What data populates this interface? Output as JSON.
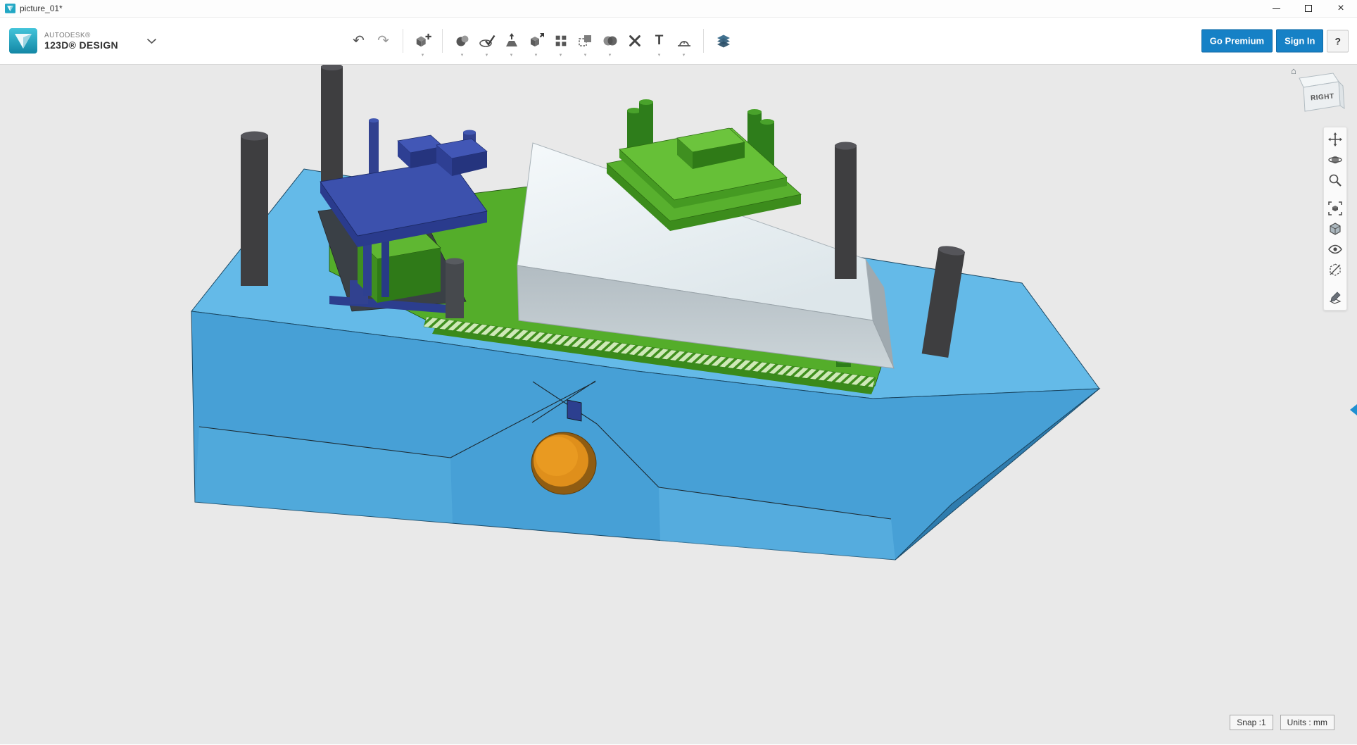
{
  "window": {
    "title": "picture_01*",
    "close_glyph": "×"
  },
  "header": {
    "brand_line1": "AUTODESK®",
    "brand_line2": "123D® DESIGN",
    "go_premium_label": "Go Premium",
    "sign_in_label": "Sign In",
    "help_label": "?"
  },
  "toolbar": {
    "undo_glyph": "↶",
    "redo_glyph": "↷",
    "text_glyph": "T",
    "drop_glyph": "▾",
    "items": [
      "undo",
      "redo",
      "primitives",
      "transform",
      "sketch",
      "construct",
      "modify",
      "pattern",
      "grouping",
      "combine",
      "snap",
      "text",
      "measure",
      "material"
    ]
  },
  "viewport": {
    "viewcube": {
      "label": "RIGHT",
      "home_glyph": "⌂"
    },
    "status": {
      "snap": "Snap :1",
      "units": "Units : mm"
    }
  },
  "model": {
    "colors": {
      "base_blue_top": "#64bae8",
      "base_blue_front": "#47a0d6",
      "base_blue_side": "#2f7cae",
      "insert_green": "#54ad2a",
      "core_navy": "#3c51ad",
      "cavity_white": "#eef3f6",
      "sprue_orange": "#df8f1b",
      "pin_dark_gray": "#3e3e40",
      "pin_dark_green": "#2e7d1b"
    },
    "parts": [
      "mold-base",
      "green-insert-plate",
      "pocket-green-block",
      "navy-core-plate",
      "white-cavity-block",
      "green-top-assembly",
      "guide-pins",
      "sprue-bushing"
    ]
  }
}
